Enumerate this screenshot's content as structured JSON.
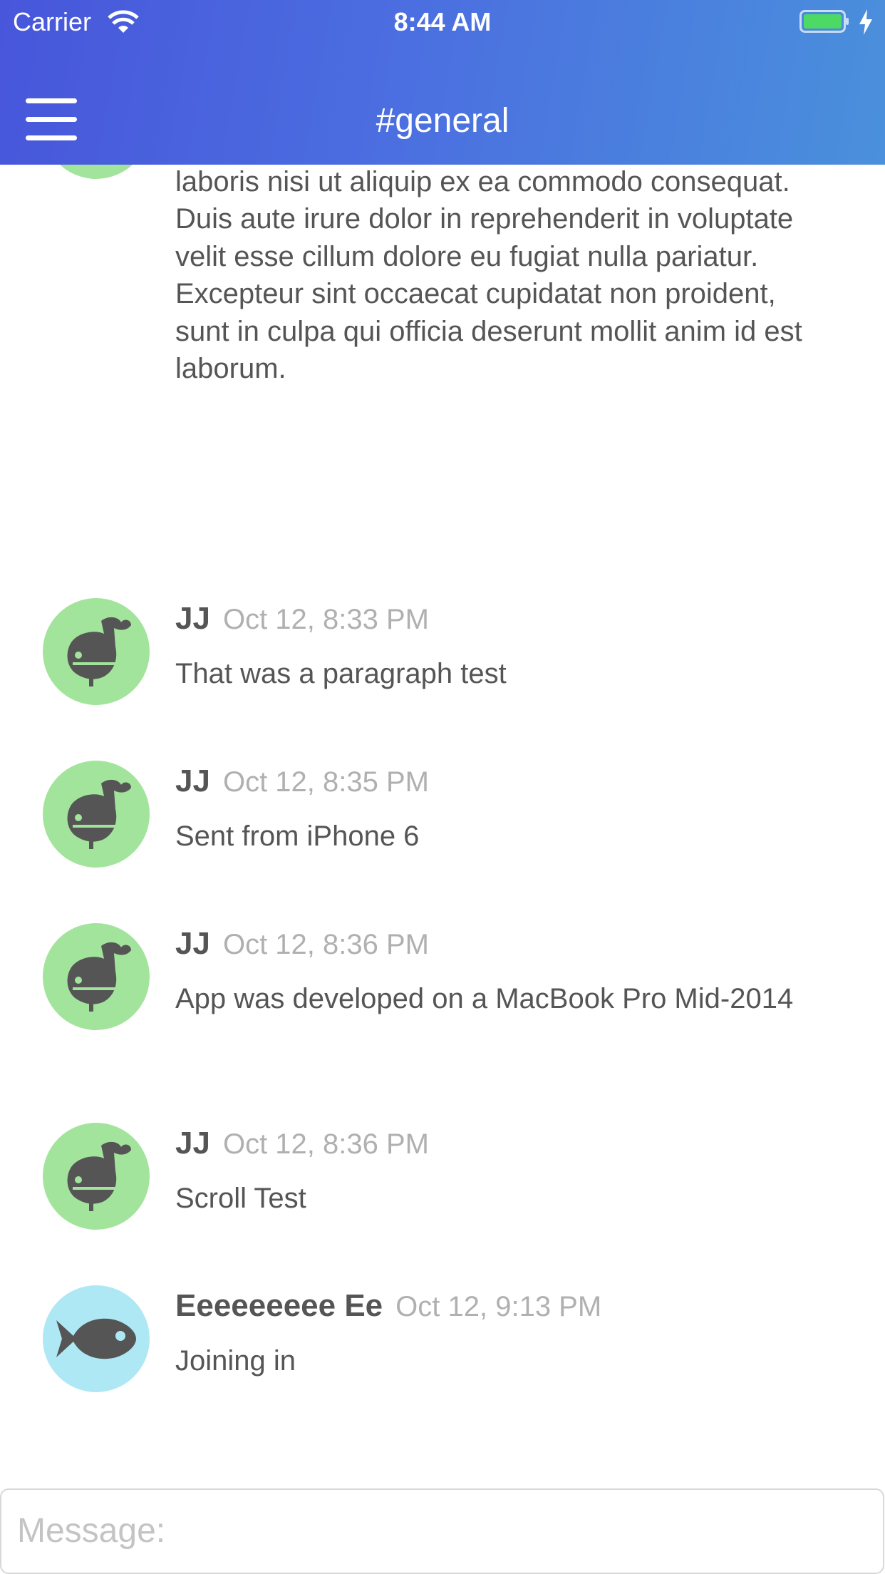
{
  "status_bar": {
    "carrier": "Carrier",
    "time": "8:44 AM"
  },
  "header": {
    "channel": "#general",
    "menu_icon": "hamburger-menu-icon"
  },
  "colors": {
    "header_start": "#4856db",
    "header_end": "#4a90dc",
    "avatar_green": "#a3e49c",
    "avatar_blue": "#aee8f4",
    "icon_dark": "#555555",
    "battery": "#4cd964"
  },
  "feed": {
    "partial_message": "adipiscing elit, sed do eiusmod tempor incididunt ut labore et dolore magna aliqua. Ut enim ad minim veniam, quis nostrud exercitation ullamco laboris nisi ut aliquip ex ea commodo consequat. Duis aute irure dolor in reprehenderit in voluptate velit esse cillum dolore eu fugiat nulla pariatur. Excepteur sint occaecat cupidatat non proident, sunt in culpa qui officia deserunt mollit anim id est laborum.",
    "messages": [
      {
        "author": "JJ",
        "time": "Oct 12, 8:33 PM",
        "text": "That was a paragraph test",
        "avatar": "whale-icon"
      },
      {
        "author": "JJ",
        "time": "Oct 12, 8:35 PM",
        "text": "Sent from iPhone 6",
        "avatar": "whale-icon"
      },
      {
        "author": "JJ",
        "time": "Oct 12, 8:36 PM",
        "text": "App was developed on a MacBook Pro Mid-2014",
        "avatar": "whale-icon"
      },
      {
        "author": "JJ",
        "time": "Oct 12, 8:36 PM",
        "text": "Scroll Test",
        "avatar": "whale-icon"
      },
      {
        "author": "Eeeeeeeee Ee",
        "time": "Oct 12, 9:13 PM",
        "text": "Joining in",
        "avatar": "fish-icon"
      }
    ]
  },
  "composer": {
    "placeholder": "Message:",
    "value": ""
  }
}
